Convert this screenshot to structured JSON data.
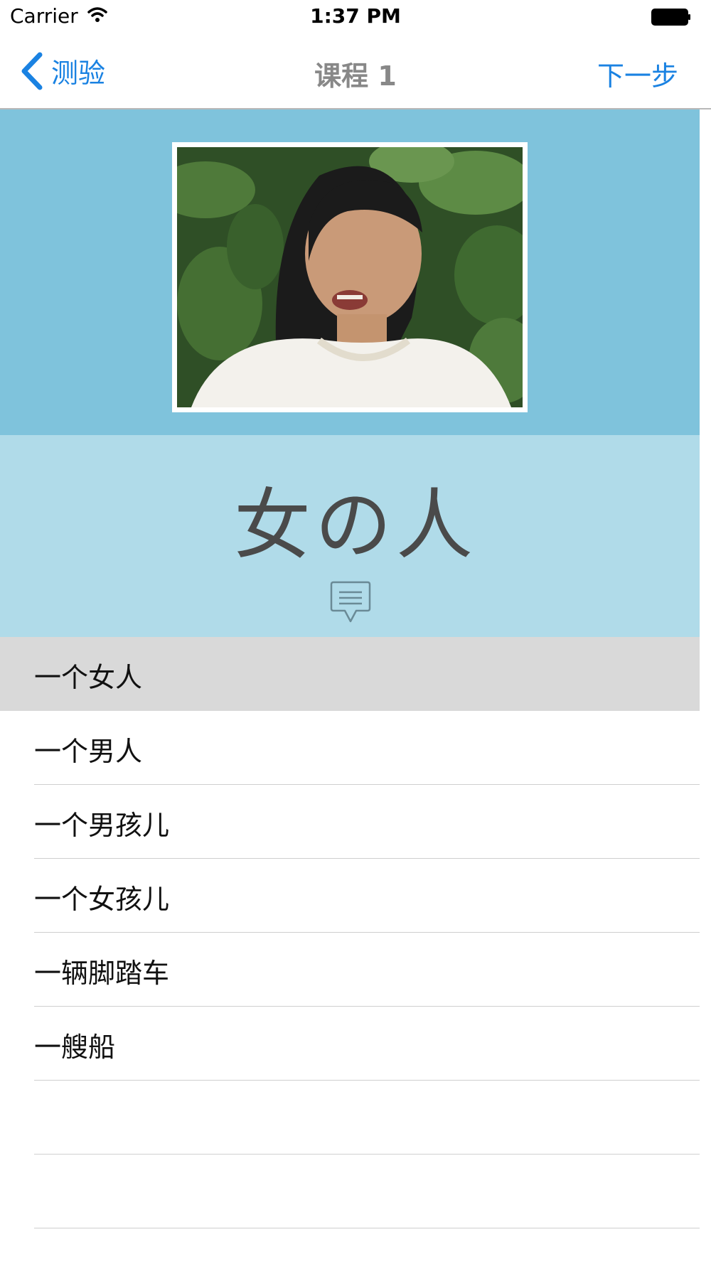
{
  "status_bar": {
    "carrier": "Carrier",
    "time": "1:37 PM"
  },
  "nav": {
    "back_label": "测验",
    "title": "课程 1",
    "next_label": "下一步"
  },
  "word": {
    "text": "女の人"
  },
  "options": [
    {
      "label": "一个女人",
      "selected": true
    },
    {
      "label": "一个男人",
      "selected": false
    },
    {
      "label": "一个男孩儿",
      "selected": false
    },
    {
      "label": "一个女孩儿",
      "selected": false
    },
    {
      "label": "一辆脚踏车",
      "selected": false
    },
    {
      "label": "一艘船",
      "selected": false
    },
    {
      "label": "",
      "selected": false
    },
    {
      "label": "",
      "selected": false
    }
  ],
  "colors": {
    "accent": "#1a82e2",
    "photo_bg": "#7fc3dc",
    "word_bg": "#b0dbe9",
    "selected_row": "#d9d9d9"
  }
}
